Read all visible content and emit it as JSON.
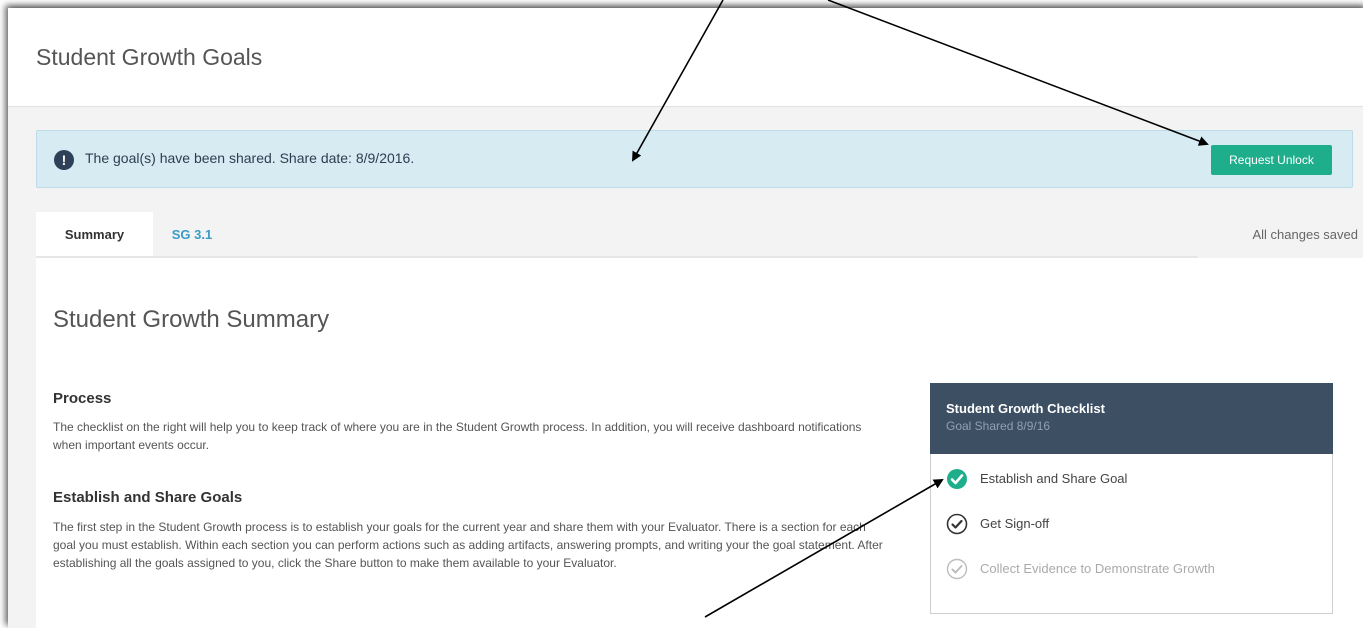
{
  "header": {
    "title": "Student Growth Goals"
  },
  "alert": {
    "message": "The goal(s) have been shared. Share date: 8/9/2016.",
    "icon": "exclamation-icon",
    "button_label": "Request Unlock"
  },
  "tabs": [
    {
      "label": "Summary",
      "active": true
    },
    {
      "label": "SG 3.1",
      "active": false
    }
  ],
  "save_status": "All changes saved",
  "summary": {
    "title": "Student Growth Summary",
    "sections": [
      {
        "heading": "Process",
        "body": "The checklist on the right will help you to keep track of where you are in the Student Growth process. In addition, you will receive dashboard notifications when important events occur."
      },
      {
        "heading": "Establish and Share Goals",
        "body": "The first step in the Student Growth process is to establish your goals for the current year and share them with your Evaluator. There is a section for each goal you must establish. Within each section you can perform actions such as adding artifacts, answering prompts, and writing your the goal statement. After establishing all the goals assigned to you, click the Share button to make them available to your Evaluator."
      }
    ]
  },
  "checklist": {
    "title": "Student Growth Checklist",
    "subtitle": "Goal Shared 8/9/16",
    "items": [
      {
        "label": "Establish and Share Goal",
        "status": "complete"
      },
      {
        "label": "Get Sign-off",
        "status": "current"
      },
      {
        "label": "Collect Evidence to Demonstrate Growth",
        "status": "pending"
      }
    ]
  },
  "colors": {
    "alert_background": "#d7ebf3",
    "button": "#1fae8c",
    "tab_link": "#3b9bc6",
    "checklist_header": "#3c4f63",
    "check_complete": "#1fae8c"
  }
}
